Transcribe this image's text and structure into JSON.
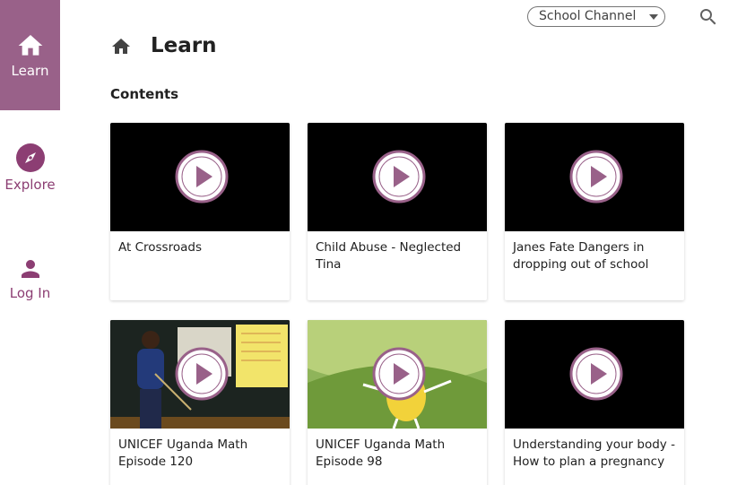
{
  "sidebar": {
    "items": [
      {
        "label": "Learn",
        "icon": "home-icon"
      },
      {
        "label": "Explore",
        "icon": "compass-icon"
      },
      {
        "label": "Log In",
        "icon": "person-icon"
      }
    ]
  },
  "header": {
    "channel_select": "School Channel",
    "search_icon": "search-icon"
  },
  "page": {
    "title": "Learn",
    "section": "Contents"
  },
  "colors": {
    "brand": "#996189",
    "brand_dark": "#8c3e73",
    "play": "#996189"
  },
  "cards": [
    {
      "title": "At Crossroads"
    },
    {
      "title": "Child Abuse - Neglected Tina"
    },
    {
      "title": "Janes Fate Dangers in dropping out of school"
    },
    {
      "title": "UNICEF Uganda Math Episode 120"
    },
    {
      "title": "UNICEF Uganda Math Episode 98"
    },
    {
      "title": "Understanding your body - How to plan a pregnancy"
    }
  ]
}
